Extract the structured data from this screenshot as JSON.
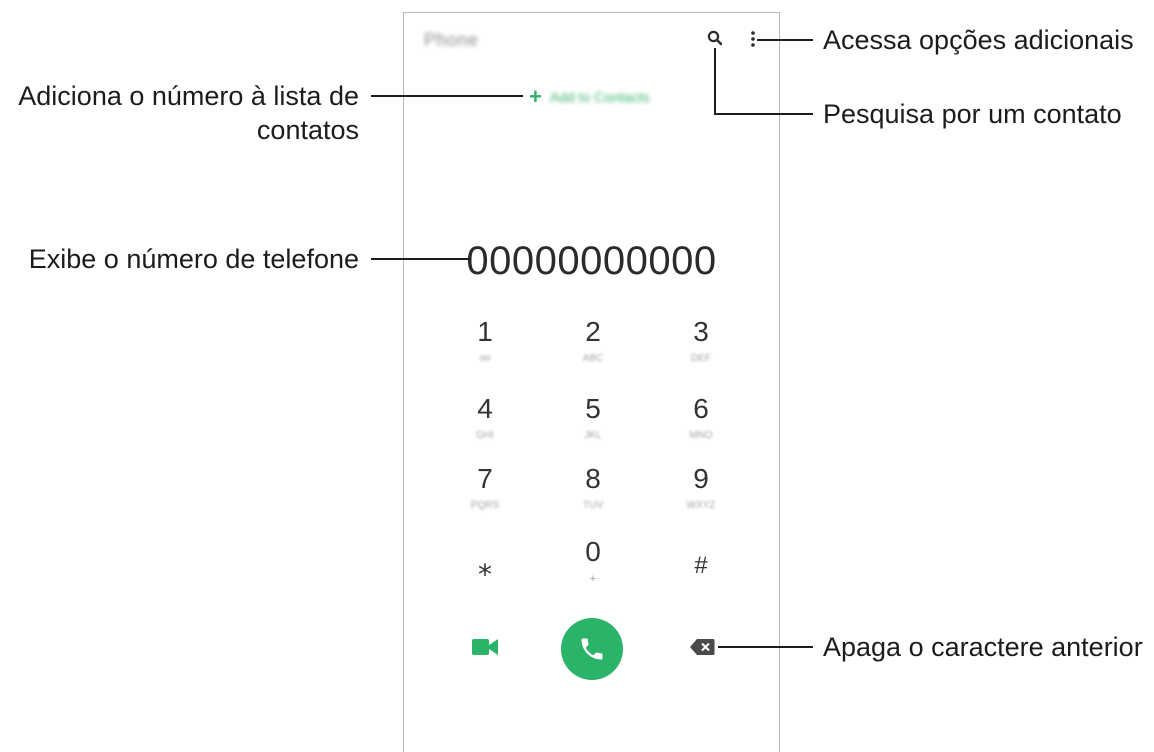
{
  "phone": {
    "title": "Phone",
    "add_contact_label": "Add to Contacts",
    "number": "00000000000",
    "keypad": [
      {
        "digit": "1",
        "sub": "oo"
      },
      {
        "digit": "2",
        "sub": "ABC"
      },
      {
        "digit": "3",
        "sub": "DEF"
      },
      {
        "digit": "4",
        "sub": "GHI"
      },
      {
        "digit": "5",
        "sub": "JKL"
      },
      {
        "digit": "6",
        "sub": "MNO"
      },
      {
        "digit": "7",
        "sub": "PQRS"
      },
      {
        "digit": "8",
        "sub": "TUV"
      },
      {
        "digit": "9",
        "sub": "WXYZ"
      },
      {
        "digit": "⁎",
        "sub": ""
      },
      {
        "digit": "0",
        "sub": "+"
      },
      {
        "digit": "#",
        "sub": ""
      }
    ],
    "accent_color": "#2bb36a"
  },
  "callouts": {
    "more_options": "Acessa opções adicionais",
    "search": "Pesquisa por um contato",
    "add_contact_line1": "Adiciona o número à lista de",
    "add_contact_line2": "contatos",
    "display_number": "Exibe o número de telefone",
    "backspace": "Apaga o caractere anterior"
  }
}
